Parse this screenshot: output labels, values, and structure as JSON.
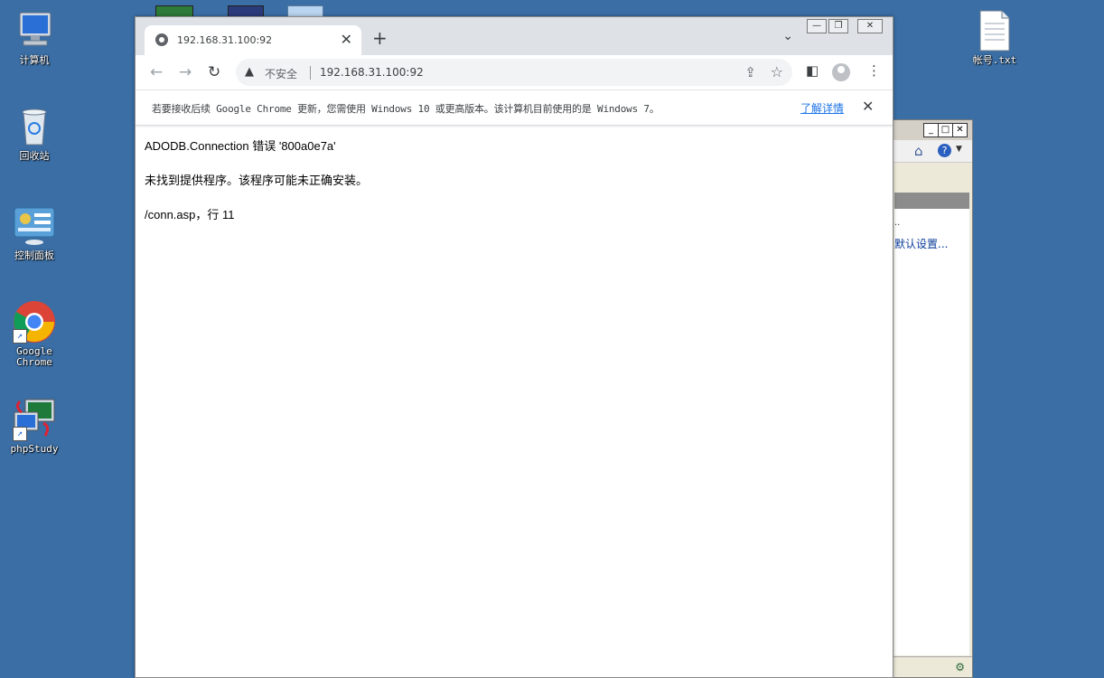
{
  "desktop": {
    "icons": [
      {
        "label": "计算机"
      },
      {
        "label": "回收站"
      },
      {
        "label": "控制面板"
      },
      {
        "label": "Google\nChrome"
      },
      {
        "label": "phpStudy"
      },
      {
        "label": "帐号.txt"
      }
    ]
  },
  "background_window": {
    "link_text": "默认设置...",
    "dots": ".."
  },
  "chrome": {
    "tab": {
      "title": "192.168.31.100:92"
    },
    "window_controls": {
      "minimize": "—",
      "restore": "❐",
      "close": "✕"
    },
    "address_bar": {
      "security_label": "不安全",
      "url": "192.168.31.100:92"
    },
    "infobar": {
      "message": "若要接收后续 Google Chrome 更新，您需使用 Windows 10 或更高版本。该计算机目前使用的是 Windows 7。",
      "learn_more": "了解详情"
    },
    "page": {
      "error_title": "ADODB.Connection 错误 '800a0e7a'",
      "error_message": "未找到提供程序。该程序可能未正确安装。",
      "error_location": "/conn.asp，行 11"
    }
  },
  "colors": {
    "desktop_bg": "#3a6ea5",
    "tabstrip_bg": "#dee1e6",
    "link": "#1a73e8"
  }
}
